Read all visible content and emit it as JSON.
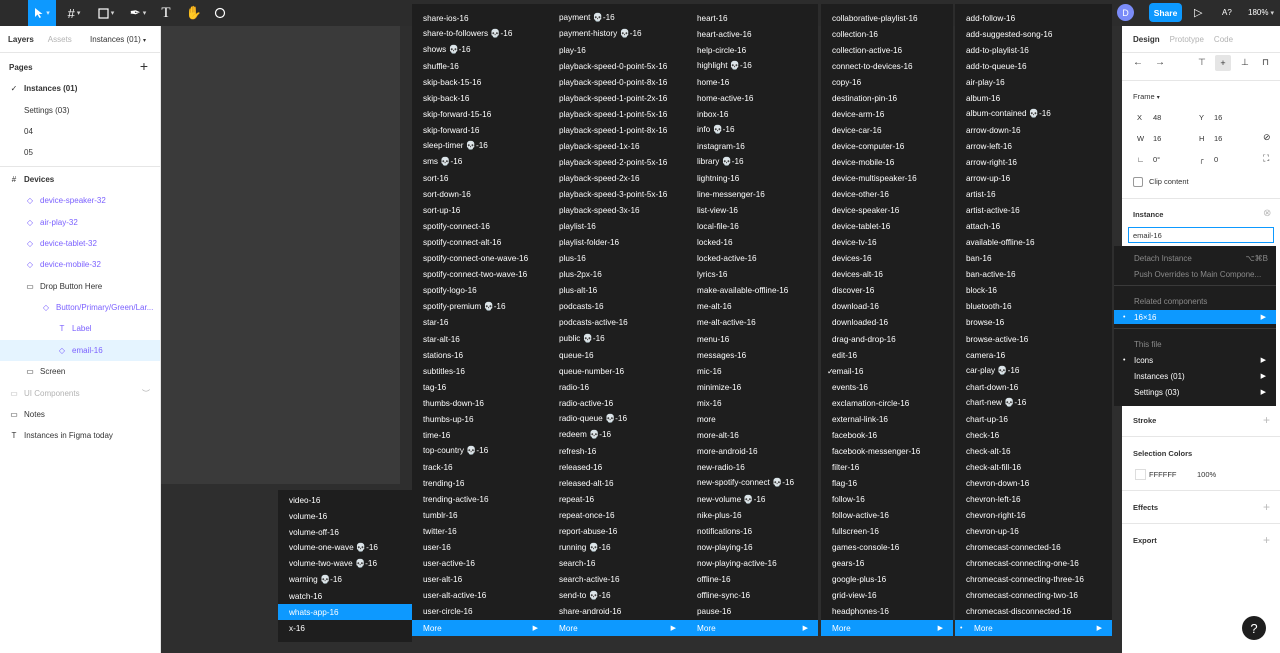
{
  "toolbar": {
    "share_label": "Share",
    "zoom": "180%",
    "avatar_initial": "D",
    "accessibility_label": "A?"
  },
  "left_panel": {
    "tab_layers": "Layers",
    "tab_assets": "Assets",
    "tab_page": "Instances (01)",
    "pages_title": "Pages",
    "pages": [
      "Instances (01)",
      "Settings (03)",
      "04",
      "05"
    ],
    "layers": [
      {
        "label": "Devices"
      },
      {
        "label": "device-speaker-32"
      },
      {
        "label": "air-play-32"
      },
      {
        "label": "device-tablet-32"
      },
      {
        "label": "device-mobile-32"
      },
      {
        "label": "Drop Button Here"
      },
      {
        "label": "Button/Primary/Green/Lar..."
      },
      {
        "label": "Label"
      },
      {
        "label": "email-16"
      },
      {
        "label": "Screen"
      },
      {
        "label": "UI Components"
      },
      {
        "label": "Notes"
      },
      {
        "label": "Instances in Figma today"
      }
    ]
  },
  "menus": {
    "col0": [
      "video-16",
      "volume-16",
      "volume-off-16",
      "volume-one-wave 💀-16",
      "volume-two-wave 💀-16",
      "warning 💀-16",
      "watch-16",
      "whats-app-16",
      "x-16"
    ],
    "col1": [
      "share-ios-16",
      "share-to-followers 💀-16",
      "shows 💀-16",
      "shuffle-16",
      "skip-back-15-16",
      "skip-back-16",
      "skip-forward-15-16",
      "skip-forward-16",
      "sleep-timer 💀-16",
      "sms 💀-16",
      "sort-16",
      "sort-down-16",
      "sort-up-16",
      "spotify-connect-16",
      "spotify-connect-alt-16",
      "spotify-connect-one-wave-16",
      "spotify-connect-two-wave-16",
      "spotify-logo-16",
      "spotify-premium 💀-16",
      "star-16",
      "star-alt-16",
      "stations-16",
      "subtitles-16",
      "tag-16",
      "thumbs-down-16",
      "thumbs-up-16",
      "time-16",
      "top-country 💀-16",
      "track-16",
      "trending-16",
      "trending-active-16",
      "tumblr-16",
      "twitter-16",
      "user-16",
      "user-active-16",
      "user-alt-16",
      "user-alt-active-16",
      "user-circle-16"
    ],
    "col2": [
      "payment 💀-16",
      "payment-history 💀-16",
      "play-16",
      "playback-speed-0-point-5x-16",
      "playback-speed-0-point-8x-16",
      "playback-speed-1-point-2x-16",
      "playback-speed-1-point-5x-16",
      "playback-speed-1-point-8x-16",
      "playback-speed-1x-16",
      "playback-speed-2-point-5x-16",
      "playback-speed-2x-16",
      "playback-speed-3-point-5x-16",
      "playback-speed-3x-16",
      "playlist-16",
      "playlist-folder-16",
      "plus-16",
      "plus-2px-16",
      "plus-alt-16",
      "podcasts-16",
      "podcasts-active-16",
      "public 💀-16",
      "queue-16",
      "queue-number-16",
      "radio-16",
      "radio-active-16",
      "radio-queue 💀-16",
      "redeem 💀-16",
      "refresh-16",
      "released-16",
      "released-alt-16",
      "repeat-16",
      "repeat-once-16",
      "report-abuse-16",
      "running 💀-16",
      "search-16",
      "search-active-16",
      "send-to 💀-16",
      "share-android-16"
    ],
    "col3": [
      "heart-16",
      "heart-active-16",
      "help-circle-16",
      "highlight 💀-16",
      "home-16",
      "home-active-16",
      "inbox-16",
      "info 💀-16",
      "instagram-16",
      "library 💀-16",
      "lightning-16",
      "line-messenger-16",
      "list-view-16",
      "local-file-16",
      "locked-16",
      "locked-active-16",
      "lyrics-16",
      "make-available-offline-16",
      "me-alt-16",
      "me-alt-active-16",
      "menu-16",
      "messages-16",
      "mic-16",
      "minimize-16",
      "mix-16",
      "more",
      "more-alt-16",
      "more-android-16",
      "new-radio-16",
      "new-spotify-connect 💀-16",
      "new-volume 💀-16",
      "nike-plus-16",
      "notifications-16",
      "now-playing-16",
      "now-playing-active-16",
      "offline-16",
      "offline-sync-16",
      "pause-16"
    ],
    "col4": [
      "collaborative-playlist-16",
      "collection-16",
      "collection-active-16",
      "connect-to-devices-16",
      "copy-16",
      "destination-pin-16",
      "device-arm-16",
      "device-car-16",
      "device-computer-16",
      "device-mobile-16",
      "device-multispeaker-16",
      "device-other-16",
      "device-speaker-16",
      "device-tablet-16",
      "device-tv-16",
      "devices-16",
      "devices-alt-16",
      "discover-16",
      "download-16",
      "downloaded-16",
      "drag-and-drop-16",
      "edit-16",
      "email-16",
      "events-16",
      "exclamation-circle-16",
      "external-link-16",
      "facebook-16",
      "facebook-messenger-16",
      "filter-16",
      "flag-16",
      "follow-16",
      "follow-active-16",
      "fullscreen-16",
      "games-console-16",
      "gears-16",
      "google-plus-16",
      "grid-view-16",
      "headphones-16"
    ],
    "col5": [
      "add-follow-16",
      "add-suggested-song-16",
      "add-to-playlist-16",
      "add-to-queue-16",
      "air-play-16",
      "album-16",
      "album-contained 💀-16",
      "arrow-down-16",
      "arrow-left-16",
      "arrow-right-16",
      "arrow-up-16",
      "artist-16",
      "artist-active-16",
      "attach-16",
      "available-offline-16",
      "ban-16",
      "ban-active-16",
      "block-16",
      "bluetooth-16",
      "browse-16",
      "browse-active-16",
      "camera-16",
      "car-play 💀-16",
      "chart-down-16",
      "chart-new 💀-16",
      "chart-up-16",
      "check-16",
      "check-alt-16",
      "check-alt-fill-16",
      "chevron-down-16",
      "chevron-left-16",
      "chevron-right-16",
      "chevron-up-16",
      "chromecast-connected-16",
      "chromecast-connecting-one-16",
      "chromecast-connecting-three-16",
      "chromecast-connecting-two-16",
      "chromecast-disconnected-16"
    ],
    "more_label": "More"
  },
  "right_panel": {
    "tab_design": "Design",
    "tab_prototype": "Prototype",
    "tab_code": "Code",
    "frame_label": "Frame",
    "x_label": "X",
    "x_val": "48",
    "y_label": "Y",
    "y_val": "16",
    "w_label": "W",
    "w_val": "16",
    "h_label": "H",
    "h_val": "16",
    "rot_val": "0°",
    "radius_val": "0",
    "clip_label": "Clip content",
    "instance_label": "Instance",
    "instance_val": "email-16",
    "stroke_label": "Stroke",
    "selcolors_label": "Selection Colors",
    "color_hex": "FFFFFF",
    "color_pct": "100%",
    "effects_label": "Effects",
    "export_label": "Export"
  },
  "context_menu": {
    "detach": "Detach Instance",
    "detach_short": "⌥⌘B",
    "push": "Push Overrides to Main Compone...",
    "related_header": "Related components",
    "related_item": "16×16",
    "thisfile_header": "This file",
    "items": [
      "Icons",
      "Instances (01)",
      "Settings (03)"
    ]
  },
  "help_label": "?"
}
